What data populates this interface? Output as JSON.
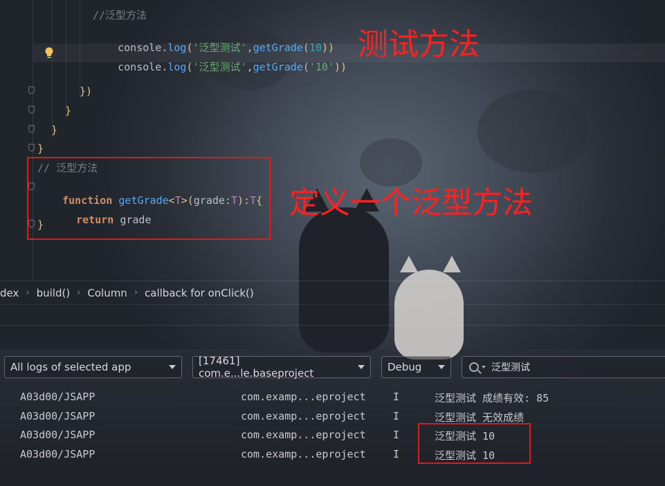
{
  "editor": {
    "comment_top": "//泛型方法",
    "line_console1": [
      "console",
      ".",
      "log",
      "(",
      "'泛型测试'",
      ",",
      "getGrade",
      "(",
      "10",
      "))"
    ],
    "line_console2": [
      "console",
      ".",
      "log",
      "(",
      "'泛型测试'",
      ",",
      "getGrade",
      "(",
      "'10'",
      "))"
    ],
    "close1": "})",
    "close2": "}",
    "close3": "}",
    "close4": "}",
    "comment_fn": "// 泛型方法",
    "fn_keyword": "function",
    "fn_name": "getGrade",
    "fn_sig_rest": [
      "<",
      "T",
      ">(",
      "grade",
      ":",
      "T",
      "):",
      "T",
      "{"
    ],
    "return_keyword": "return",
    "return_value": "grade",
    "fn_close": "}"
  },
  "annotations": {
    "test_method": "测试方法",
    "define_generic": "定义一个泛型方法"
  },
  "breadcrumb": [
    "dex",
    "build()",
    "Column",
    "callback for onClick()"
  ],
  "log_toolbar": {
    "app_filter": "All logs of selected app",
    "process": "[17461] com.e...le.baseproject",
    "level": "Debug",
    "search_value": "泛型测试"
  },
  "logs": [
    {
      "tag": "A03d00/JSAPP",
      "pkg": "com.examp...eproject",
      "level": "I",
      "msg": "泛型测试 成绩有效: 85"
    },
    {
      "tag": "A03d00/JSAPP",
      "pkg": "com.examp...eproject",
      "level": "I",
      "msg": "泛型测试 无效成绩"
    },
    {
      "tag": "A03d00/JSAPP",
      "pkg": "com.examp...eproject",
      "level": "I",
      "msg": "泛型测试 10"
    },
    {
      "tag": "A03d00/JSAPP",
      "pkg": "com.examp...eproject",
      "level": "I",
      "msg": "泛型测试 10"
    }
  ],
  "colors": {
    "annotation_red": "#ff2020",
    "keyword": "#cf8e6d",
    "function": "#56a8f5",
    "string": "#6aab73",
    "number": "#2aacb8"
  }
}
